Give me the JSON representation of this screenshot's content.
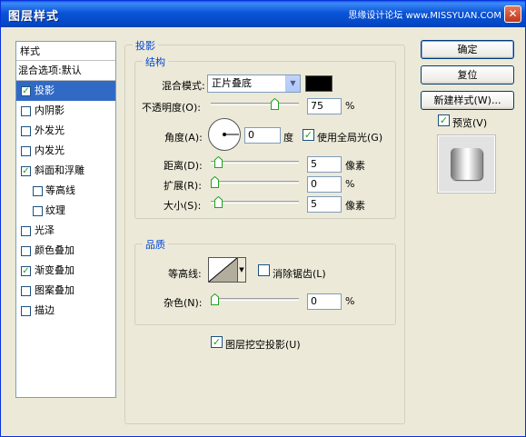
{
  "window": {
    "title": "图层样式",
    "watermark": "思缘设计论坛 www.MISSYUAN.COM",
    "close_glyph": "✕"
  },
  "style_list": {
    "header": "样式",
    "blend_options": "混合选项:默认",
    "items": [
      {
        "label": "投影",
        "checked": true,
        "selected": true
      },
      {
        "label": "内阴影",
        "checked": false
      },
      {
        "label": "外发光",
        "checked": false
      },
      {
        "label": "内发光",
        "checked": false
      },
      {
        "label": "斜面和浮雕",
        "checked": true
      },
      {
        "label": "等高线",
        "checked": false,
        "sub": true
      },
      {
        "label": "纹理",
        "checked": false,
        "sub": true
      },
      {
        "label": "光泽",
        "checked": false
      },
      {
        "label": "颜色叠加",
        "checked": false
      },
      {
        "label": "渐变叠加",
        "checked": true
      },
      {
        "label": "图案叠加",
        "checked": false
      },
      {
        "label": "描边",
        "checked": false
      }
    ]
  },
  "panel": {
    "title": "投影",
    "structure": {
      "title": "结构",
      "blend_mode_label": "混合模式:",
      "blend_mode_value": "正片叠底",
      "blend_color": "#000000",
      "opacity_label": "不透明度(O):",
      "opacity_value": "75",
      "opacity_unit": "%",
      "angle_label": "角度(A):",
      "angle_value": "0",
      "angle_unit": "度",
      "global_light_label": "使用全局光(G)",
      "global_light_checked": true,
      "distance_label": "距离(D):",
      "distance_value": "5",
      "distance_unit": "像素",
      "spread_label": "扩展(R):",
      "spread_value": "0",
      "spread_unit": "%",
      "size_label": "大小(S):",
      "size_value": "5",
      "size_unit": "像素"
    },
    "quality": {
      "title": "品质",
      "contour_label": "等高线:",
      "anti_alias_label": "消除锯齿(L)",
      "anti_alias_checked": false,
      "noise_label": "杂色(N):",
      "noise_value": "0",
      "noise_unit": "%"
    },
    "knockout_label": "图层挖空投影(U)",
    "knockout_checked": true
  },
  "buttons": {
    "ok": "确定",
    "reset": "复位",
    "new_style": "新建样式(W)...",
    "preview_label": "预览(V)",
    "preview_checked": true
  },
  "colors": {
    "accent": "#316ac5",
    "title_bar": "#0a54d8",
    "group_title": "#0046d5"
  }
}
